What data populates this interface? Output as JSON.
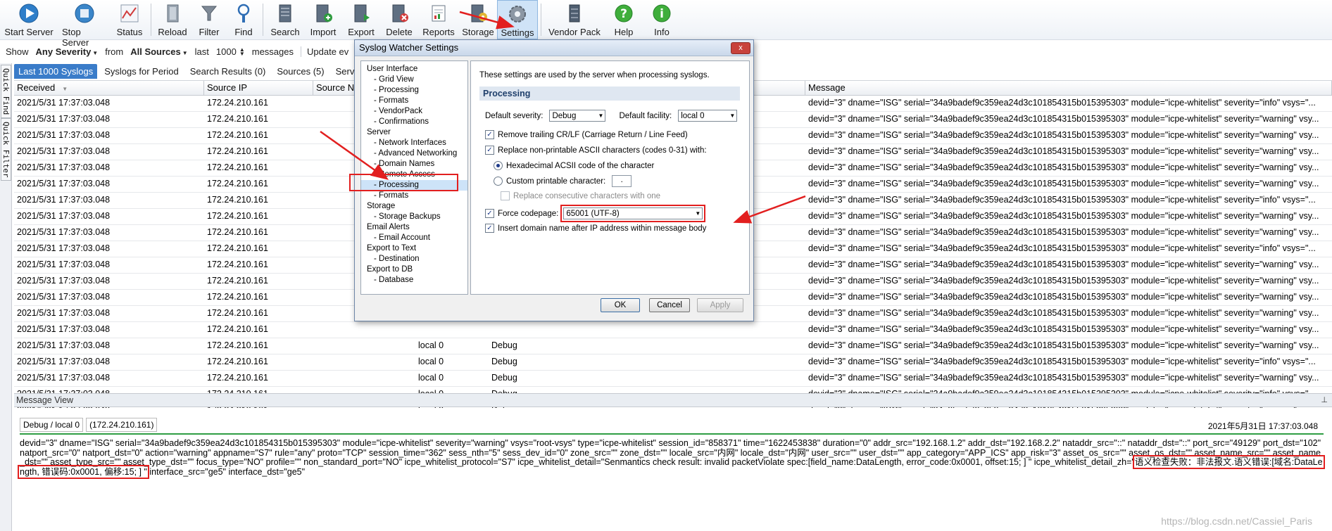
{
  "toolbar": {
    "buttons": [
      {
        "label": "Start Server",
        "icon": "play-icon"
      },
      {
        "label": "Stop Server",
        "icon": "stop-icon"
      },
      {
        "label": "Status",
        "icon": "chart-icon"
      },
      {
        "label": "Reload",
        "icon": "reload-icon"
      },
      {
        "label": "Filter",
        "icon": "funnel-icon"
      },
      {
        "label": "Find",
        "icon": "find-icon"
      },
      {
        "label": "Search",
        "icon": "search-icon"
      },
      {
        "label": "Import",
        "icon": "import-icon"
      },
      {
        "label": "Export",
        "icon": "export-icon"
      },
      {
        "label": "Delete",
        "icon": "delete-icon"
      },
      {
        "label": "Reports",
        "icon": "reports-icon"
      },
      {
        "label": "Storage",
        "icon": "storage-icon"
      },
      {
        "label": "Settings",
        "icon": "gear-icon"
      },
      {
        "label": "Vendor Pack",
        "icon": "vendor-pack-icon"
      },
      {
        "label": "Help",
        "icon": "help-icon"
      },
      {
        "label": "Info",
        "icon": "info-icon"
      }
    ]
  },
  "filter": {
    "show_label": "Show",
    "severity": "Any Severity",
    "from_label": "from",
    "sources": "All Sources",
    "last_label": "last",
    "count": "1000",
    "messages_label": "messages",
    "update_label": "Update ev"
  },
  "side_tabs": [
    "Quick Find",
    "Quick Filter"
  ],
  "tabs": [
    "Last 1000 Syslogs",
    "Syslogs for Period",
    "Search Results (0)",
    "Sources (5)",
    "Server L"
  ],
  "grid": {
    "headers": [
      "Received",
      "Source IP",
      "Source Na",
      "",
      "Message"
    ],
    "rows": [
      {
        "received": "2021/5/31 17:37:03.048",
        "ip": "172.24.210.161",
        "facility": "",
        "severity": "",
        "message": "devid=\"3\" dname=\"ISG\" serial=\"34a9badef9c359ea24d3c101854315b015395303\" module=\"icpe-whitelist\" severity=\"info\" vsys=\"..."
      },
      {
        "received": "2021/5/31 17:37:03.048",
        "ip": "172.24.210.161",
        "facility": "",
        "severity": "",
        "message": "devid=\"3\" dname=\"ISG\" serial=\"34a9badef9c359ea24d3c101854315b015395303\" module=\"icpe-whitelist\" severity=\"warning\" vsy..."
      },
      {
        "received": "2021/5/31 17:37:03.048",
        "ip": "172.24.210.161",
        "facility": "",
        "severity": "",
        "message": "devid=\"3\" dname=\"ISG\" serial=\"34a9badef9c359ea24d3c101854315b015395303\" module=\"icpe-whitelist\" severity=\"warning\" vsy..."
      },
      {
        "received": "2021/5/31 17:37:03.048",
        "ip": "172.24.210.161",
        "facility": "",
        "severity": "",
        "message": "devid=\"3\" dname=\"ISG\" serial=\"34a9badef9c359ea24d3c101854315b015395303\" module=\"icpe-whitelist\" severity=\"warning\" vsy..."
      },
      {
        "received": "2021/5/31 17:37:03.048",
        "ip": "172.24.210.161",
        "facility": "",
        "severity": "",
        "message": "devid=\"3\" dname=\"ISG\" serial=\"34a9badef9c359ea24d3c101854315b015395303\" module=\"icpe-whitelist\" severity=\"warning\" vsy..."
      },
      {
        "received": "2021/5/31 17:37:03.048",
        "ip": "172.24.210.161",
        "facility": "",
        "severity": "",
        "message": "devid=\"3\" dname=\"ISG\" serial=\"34a9badef9c359ea24d3c101854315b015395303\" module=\"icpe-whitelist\" severity=\"warning\" vsy..."
      },
      {
        "received": "2021/5/31 17:37:03.048",
        "ip": "172.24.210.161",
        "facility": "",
        "severity": "",
        "message": "devid=\"3\" dname=\"ISG\" serial=\"34a9badef9c359ea24d3c101854315b015395303\" module=\"icpe-whitelist\" severity=\"info\" vsys=\"..."
      },
      {
        "received": "2021/5/31 17:37:03.048",
        "ip": "172.24.210.161",
        "facility": "",
        "severity": "",
        "message": "devid=\"3\" dname=\"ISG\" serial=\"34a9badef9c359ea24d3c101854315b015395303\" module=\"icpe-whitelist\" severity=\"warning\" vsy..."
      },
      {
        "received": "2021/5/31 17:37:03.048",
        "ip": "172.24.210.161",
        "facility": "",
        "severity": "",
        "message": "devid=\"3\" dname=\"ISG\" serial=\"34a9badef9c359ea24d3c101854315b015395303\" module=\"icpe-whitelist\" severity=\"warning\" vsy..."
      },
      {
        "received": "2021/5/31 17:37:03.048",
        "ip": "172.24.210.161",
        "facility": "",
        "severity": "",
        "message": "devid=\"3\" dname=\"ISG\" serial=\"34a9badef9c359ea24d3c101854315b015395303\" module=\"icpe-whitelist\" severity=\"info\" vsys=\"..."
      },
      {
        "received": "2021/5/31 17:37:03.048",
        "ip": "172.24.210.161",
        "facility": "",
        "severity": "",
        "message": "devid=\"3\" dname=\"ISG\" serial=\"34a9badef9c359ea24d3c101854315b015395303\" module=\"icpe-whitelist\" severity=\"warning\" vsy..."
      },
      {
        "received": "2021/5/31 17:37:03.048",
        "ip": "172.24.210.161",
        "facility": "",
        "severity": "",
        "message": "devid=\"3\" dname=\"ISG\" serial=\"34a9badef9c359ea24d3c101854315b015395303\" module=\"icpe-whitelist\" severity=\"warning\" vsy..."
      },
      {
        "received": "2021/5/31 17:37:03.048",
        "ip": "172.24.210.161",
        "facility": "",
        "severity": "",
        "message": "devid=\"3\" dname=\"ISG\" serial=\"34a9badef9c359ea24d3c101854315b015395303\" module=\"icpe-whitelist\" severity=\"warning\" vsy..."
      },
      {
        "received": "2021/5/31 17:37:03.048",
        "ip": "172.24.210.161",
        "facility": "",
        "severity": "",
        "message": "devid=\"3\" dname=\"ISG\" serial=\"34a9badef9c359ea24d3c101854315b015395303\" module=\"icpe-whitelist\" severity=\"warning\" vsy..."
      },
      {
        "received": "2021/5/31 17:37:03.048",
        "ip": "172.24.210.161",
        "facility": "",
        "severity": "",
        "message": "devid=\"3\" dname=\"ISG\" serial=\"34a9badef9c359ea24d3c101854315b015395303\" module=\"icpe-whitelist\" severity=\"warning\" vsy..."
      },
      {
        "received": "2021/5/31 17:37:03.048",
        "ip": "172.24.210.161",
        "facility": "local 0",
        "severity": "Debug",
        "message": "devid=\"3\" dname=\"ISG\" serial=\"34a9badef9c359ea24d3c101854315b015395303\" module=\"icpe-whitelist\" severity=\"warning\" vsy..."
      },
      {
        "received": "2021/5/31 17:37:03.048",
        "ip": "172.24.210.161",
        "facility": "local 0",
        "severity": "Debug",
        "message": "devid=\"3\" dname=\"ISG\" serial=\"34a9badef9c359ea24d3c101854315b015395303\" module=\"icpe-whitelist\" severity=\"info\" vsys=\"..."
      },
      {
        "received": "2021/5/31 17:37:03.048",
        "ip": "172.24.210.161",
        "facility": "local 0",
        "severity": "Debug",
        "message": "devid=\"3\" dname=\"ISG\" serial=\"34a9badef9c359ea24d3c101854315b015395303\" module=\"icpe-whitelist\" severity=\"warning\" vsy..."
      },
      {
        "received": "2021/5/31 17:37:03.048",
        "ip": "172.24.210.161",
        "facility": "local 0",
        "severity": "Debug",
        "message": "devid=\"3\" dname=\"ISG\" serial=\"34a9badef9c359ea24d3c101854315b015395303\" module=\"icpe-whitelist\" severity=\"info\" vsys=\"..."
      },
      {
        "received": "2021/5/31 17:37:03.048",
        "ip": "172.24.210.161",
        "facility": "local 0",
        "severity": "Debug",
        "message": "devid=\"3\" dname=\"ISG\" serial=\"34a9badef9c359ea24d3c101854315b015395303\" module=\"icpe-whitelist\" severity=\"warning\" vsy..."
      }
    ]
  },
  "message_view": {
    "title": "Message View",
    "severity_facility": "Debug / local 0",
    "source_ip": "(172.24.210.161)",
    "datetime": "2021年5月31日  17:37:03.048",
    "text_before": "devid=\"3\" dname=\"ISG\" serial=\"34a9badef9c359ea24d3c101854315b015395303\" module=\"icpe-whitelist\" severity=\"warning\" vsys=\"root-vsys\" type=\"icpe-whitelist\" session_id=\"858371\" time=\"1622453838\" duration=\"0\" addr_src=\"192.168.1.2\" addr_dst=\"192.168.2.2\" nataddr_src=\"::\" nataddr_dst=\"::\" port_src=\"49129\" port_dst=\"102\" natport_src=\"0\" natport_dst=\"0\" action=\"warning\" appname=\"S7\" rule=\"any\" proto=\"TCP\" session_time=\"362\" sess_nth=\"5\" sess_dev_id=\"0\" zone_src=\"\" zone_dst=\"\" locale_src=\"内网\" locale_dst=\"内网\" user_src=\"\" user_dst=\"\" app_category=\"APP_ICS\" app_risk=\"3\" asset_os_src=\"\" asset_os_dst=\"\" asset_name_src=\"\" asset_name_dst=\"\" asset_type_src=\"\" asset_type_dst=\"\" focus_type=\"NO\" profile=\"\" non_standard_port=\"NO\" icpe_whitelist_protocol=\"S7\" icpe_whitelist_detail=\"Senmantics check result: invalid packetViolate spec:[field_name:DataLength, error_code:0x0001, offset:15; ] \" icpe_whitelist_detail_zh=\"",
    "text_highlight": "语义检查失败：非法报文.语义错误:[域名:DataLength, 错误码:0x0001, 偏移:15; ] \"",
    "text_after": " interface_src=\"ge5\" interface_dst=\"ge5\"",
    "watermark": "https://blog.csdn.net/Cassiel_Paris"
  },
  "dialog": {
    "title": "Syslog Watcher Settings",
    "tree": [
      {
        "label": "User Interface",
        "sub": false
      },
      {
        "label": "- Grid View",
        "sub": true
      },
      {
        "label": "- Processing",
        "sub": true
      },
      {
        "label": "- Formats",
        "sub": true
      },
      {
        "label": "- VendorPack",
        "sub": true
      },
      {
        "label": "- Confirmations",
        "sub": true
      },
      {
        "label": "Server",
        "sub": false
      },
      {
        "label": "- Network Interfaces",
        "sub": true
      },
      {
        "label": "- Advanced Networking",
        "sub": true
      },
      {
        "label": "- Domain Names",
        "sub": true
      },
      {
        "label": "- Remote Access",
        "sub": true
      },
      {
        "label": "- Processing",
        "sub": true,
        "selected": true
      },
      {
        "label": "- Formats",
        "sub": true
      },
      {
        "label": "Storage",
        "sub": false
      },
      {
        "label": "- Storage Backups",
        "sub": true
      },
      {
        "label": "Email Alerts",
        "sub": false
      },
      {
        "label": "- Email Account",
        "sub": true
      },
      {
        "label": "Export to Text",
        "sub": false
      },
      {
        "label": "- Destination",
        "sub": true
      },
      {
        "label": "Export to DB",
        "sub": false
      },
      {
        "label": "- Database",
        "sub": true
      }
    ],
    "description": "These settings are used by the server when processing syslogs.",
    "section_title": "Processing",
    "default_severity_label": "Default severity:",
    "default_severity_value": "Debug",
    "default_facility_label": "Default facility:",
    "default_facility_value": "local 0",
    "remove_crlf_label": "Remove trailing CR/LF (Carriage Return / Line Feed)",
    "replace_nonprintable_label": "Replace non-printable ASCII characters (codes 0-31) with:",
    "hex_label": "Hexadecimal ACSII code of the character",
    "custom_label": "Custom printable character:",
    "custom_value": ".",
    "replace_consecutive_label": "Replace consecutive characters with one",
    "force_codepage_label": "Force codepage:",
    "force_codepage_value": "65001 (UTF-8)",
    "insert_domain_label": "Insert domain name after IP address within message body",
    "ok_label": "OK",
    "cancel_label": "Cancel",
    "apply_label": "Apply",
    "close_label": "x"
  },
  "colors": {
    "selected_tab": "#3a7cc9",
    "annotation_red": "#e21f1f",
    "rule_green": "#2f9e44"
  }
}
